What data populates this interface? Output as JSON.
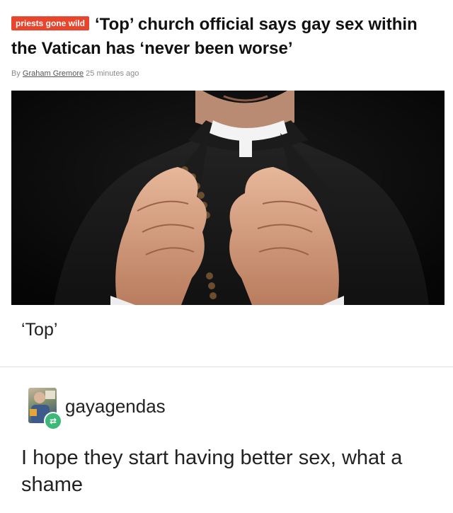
{
  "article": {
    "tag": "priests gone wild",
    "headline": "‘Top’ church official says gay sex within the Vatican has ‘never been worse’",
    "byline_prefix": "By",
    "author": "Graham Gremore",
    "time": "25 minutes ago",
    "photo_icon": "priest-hands-rosary-photo"
  },
  "caption": "‘Top’",
  "reblog": {
    "username": "gayagendas",
    "icon": "reblog-icon",
    "badge_color": "#3cb878",
    "comment": "I hope they start having better sex, what a shame"
  },
  "colors": {
    "tag_bg": "#e8452c"
  }
}
